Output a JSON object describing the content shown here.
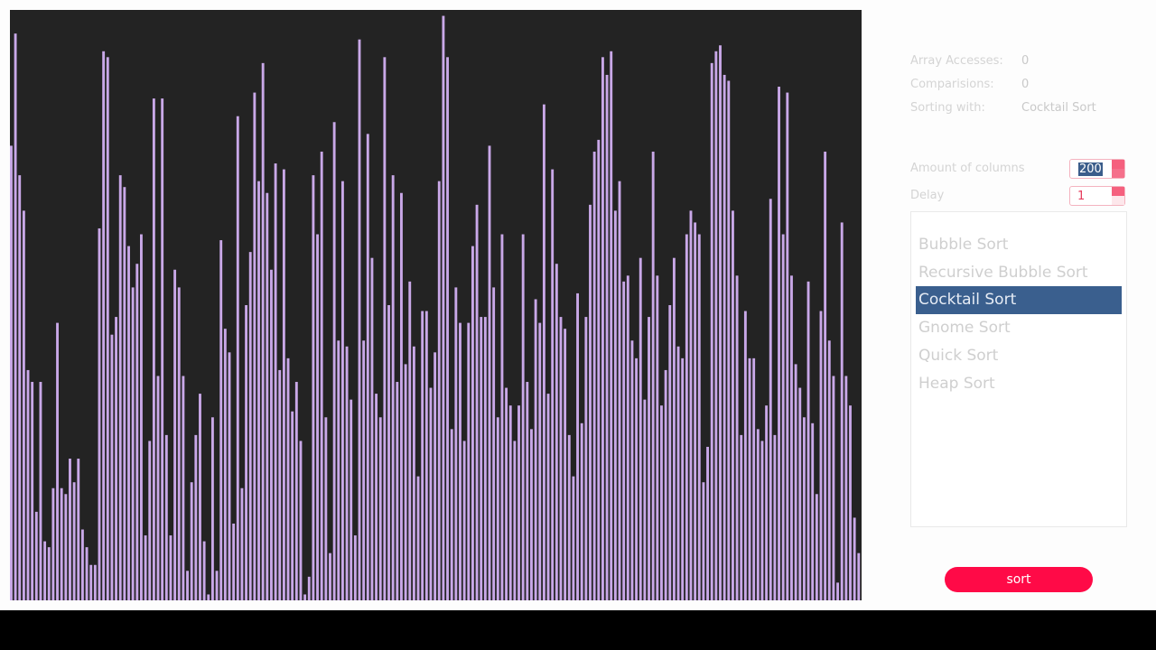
{
  "stats": [
    {
      "label": "Array Accesses:",
      "value": "0"
    },
    {
      "label": "Comparisions:",
      "value": "0"
    },
    {
      "label": "Sorting with:",
      "value": "Cocktail Sort"
    }
  ],
  "controls": {
    "columns_label": "Amount of columns",
    "columns_value": "200",
    "delay_label": "Delay",
    "delay_value": "1"
  },
  "algorithms": [
    {
      "label": "Bubble Sort",
      "selected": false
    },
    {
      "label": "Recursive Bubble Sort",
      "selected": false
    },
    {
      "label": "Cocktail Sort",
      "selected": true
    },
    {
      "label": "Gnome Sort",
      "selected": false
    },
    {
      "label": "Quick Sort",
      "selected": false
    },
    {
      "label": "Heap Sort",
      "selected": false
    }
  ],
  "sort_button": "sort",
  "colors": {
    "canvas_bg": "#232323",
    "bar": "#c9a8e8",
    "accent": "#ff0a47",
    "selected": "#3a5f8e"
  },
  "chart_data": {
    "type": "bar",
    "column_count": 200,
    "ylim": [
      0,
      1
    ],
    "values": [
      0.77,
      0.96,
      0.72,
      0.66,
      0.39,
      0.37,
      0.15,
      0.37,
      0.1,
      0.09,
      0.19,
      0.47,
      0.19,
      0.18,
      0.24,
      0.2,
      0.24,
      0.12,
      0.09,
      0.06,
      0.06,
      0.63,
      0.93,
      0.92,
      0.45,
      0.48,
      0.72,
      0.7,
      0.6,
      0.53,
      0.57,
      0.62,
      0.11,
      0.27,
      0.85,
      0.38,
      0.85,
      0.28,
      0.11,
      0.56,
      0.53,
      0.38,
      0.05,
      0.2,
      0.28,
      0.35,
      0.1,
      0.01,
      0.31,
      0.05,
      0.61,
      0.46,
      0.42,
      0.13,
      0.82,
      0.19,
      0.5,
      0.59,
      0.86,
      0.71,
      0.91,
      0.69,
      0.56,
      0.74,
      0.39,
      0.73,
      0.41,
      0.32,
      0.37,
      0.27,
      0.01,
      0.04,
      0.72,
      0.62,
      0.76,
      0.31,
      0.08,
      0.81,
      0.44,
      0.71,
      0.43,
      0.34,
      0.11,
      0.95,
      0.44,
      0.79,
      0.58,
      0.35,
      0.31,
      0.92,
      0.5,
      0.72,
      0.37,
      0.69,
      0.4,
      0.54,
      0.43,
      0.21,
      0.49,
      0.49,
      0.36,
      0.42,
      0.71,
      0.99,
      0.92,
      0.29,
      0.53,
      0.47,
      0.27,
      0.47,
      0.6,
      0.67,
      0.48,
      0.48,
      0.77,
      0.53,
      0.31,
      0.62,
      0.36,
      0.33,
      0.27,
      0.33,
      0.62,
      0.37,
      0.29,
      0.51,
      0.47,
      0.84,
      0.35,
      0.73,
      0.57,
      0.48,
      0.46,
      0.28,
      0.21,
      0.52,
      0.3,
      0.48,
      0.67,
      0.76,
      0.78,
      0.92,
      0.89,
      0.93,
      0.66,
      0.71,
      0.54,
      0.55,
      0.44,
      0.41,
      0.58,
      0.34,
      0.48,
      0.76,
      0.55,
      0.33,
      0.39,
      0.5,
      0.58,
      0.43,
      0.41,
      0.62,
      0.66,
      0.64,
      0.62,
      0.2,
      0.26,
      0.91,
      0.93,
      0.94,
      0.89,
      0.88,
      0.66,
      0.55,
      0.28,
      0.49,
      0.41,
      0.41,
      0.29,
      0.27,
      0.33,
      0.68,
      0.28,
      0.87,
      0.62,
      0.86,
      0.55,
      0.4,
      0.36,
      0.31,
      0.54,
      0.3,
      0.18,
      0.49,
      0.76,
      0.44,
      0.38,
      0.03,
      0.64,
      0.38,
      0.33,
      0.14,
      0.08
    ]
  }
}
